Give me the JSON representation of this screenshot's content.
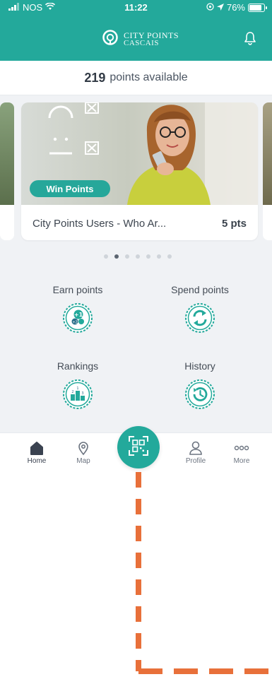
{
  "status_bar": {
    "carrier": "NOS",
    "time": "11:22",
    "battery": "76%",
    "battery_level": 0.76
  },
  "header": {
    "brand_line1": "CITY POINTS",
    "brand_line2": "CASCAIS",
    "icons": [
      "city-points-logo-icon",
      "bell-icon"
    ]
  },
  "points": {
    "value": "219",
    "label": "points available"
  },
  "carousel": {
    "card": {
      "badge": "Win Points",
      "title": "City Points Users - Who Ar...",
      "points": "5 pts"
    },
    "page_count": 7,
    "active_index": 1
  },
  "actions": [
    {
      "label": "Earn points",
      "icon": "earn-points-icon"
    },
    {
      "label": "Spend points",
      "icon": "exchange-icon"
    },
    {
      "label": "Rankings",
      "icon": "podium-icon"
    },
    {
      "label": "History",
      "icon": "history-clock-icon"
    }
  ],
  "nav": {
    "home": "Home",
    "map": "Map",
    "profile": "Profile",
    "more": "More",
    "scan_icon": "qr-scan-icon"
  },
  "colors": {
    "brand": "#23a99b",
    "background": "#f0f2f5",
    "callout": "#e8703a"
  }
}
